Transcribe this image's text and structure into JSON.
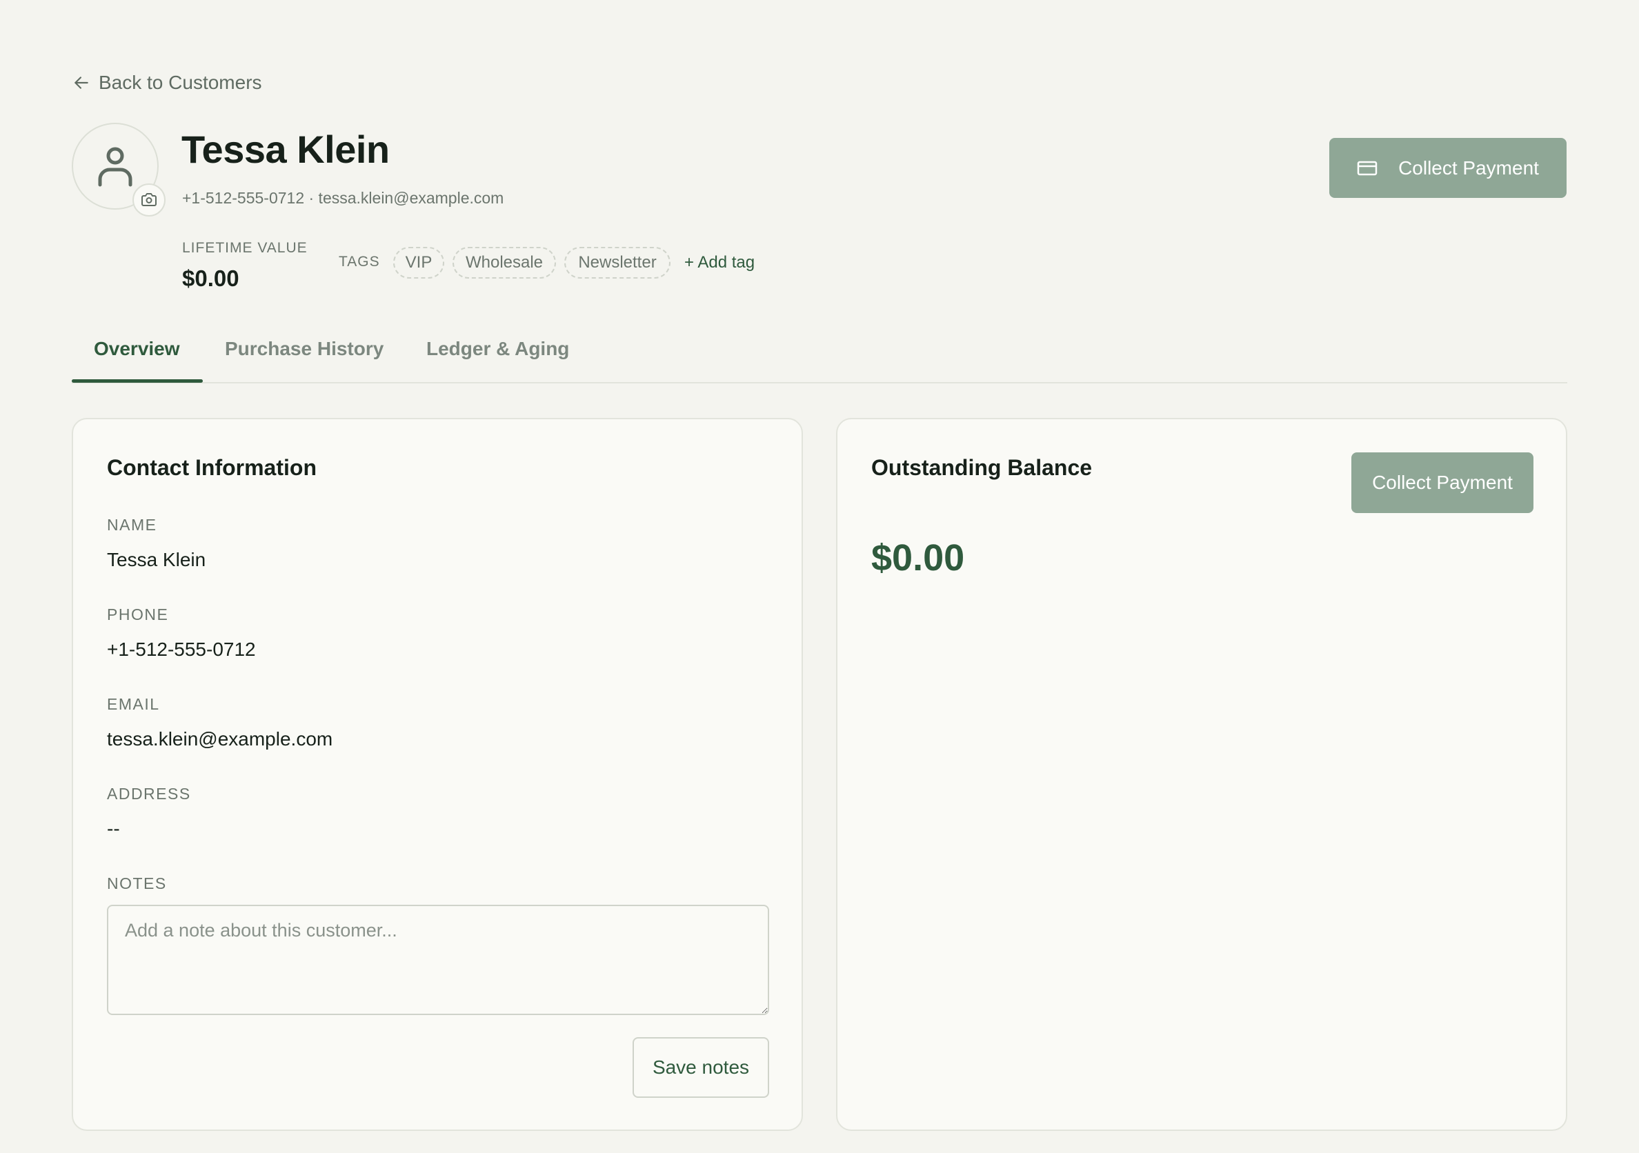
{
  "nav": {
    "back_label": "Back to Customers"
  },
  "customer": {
    "name": "Tessa Klein",
    "contact_line": "+1-512-555-0712 · tessa.klein@example.com",
    "lifetime_value_label": "LIFETIME VALUE",
    "lifetime_value": "$0.00"
  },
  "header": {
    "collect_payment_label": "Collect Payment"
  },
  "tags": {
    "label": "TAGS",
    "items": [
      "VIP",
      "Wholesale",
      "Newsletter"
    ],
    "add_label": "+ Add tag"
  },
  "tabs": [
    {
      "label": "Overview",
      "active": true
    },
    {
      "label": "Purchase History",
      "active": false
    },
    {
      "label": "Ledger & Aging",
      "active": false
    }
  ],
  "contact_card": {
    "title": "Contact Information",
    "name_label": "NAME",
    "name_value": "Tessa Klein",
    "phone_label": "PHONE",
    "phone_value": "+1-512-555-0712",
    "email_label": "EMAIL",
    "email_value": "tessa.klein@example.com",
    "address_label": "ADDRESS",
    "address_value": "--",
    "notes_label": "NOTES",
    "notes_placeholder": "Add a note about this customer...",
    "notes_value": "",
    "save_label": "Save notes"
  },
  "balance_card": {
    "title": "Outstanding Balance",
    "collect_label": "Collect Payment",
    "amount": "$0.00"
  },
  "colors": {
    "page_bg": "#f4f4ef",
    "card_bg": "#fafaf6",
    "accent_green": "#2f5a3d",
    "button_muted_green": "#8fa796",
    "muted_text": "#6b756d"
  },
  "icons": {
    "back": "arrow-left-icon",
    "avatar": "user-icon",
    "camera": "camera-icon",
    "payment": "credit-card-icon"
  }
}
